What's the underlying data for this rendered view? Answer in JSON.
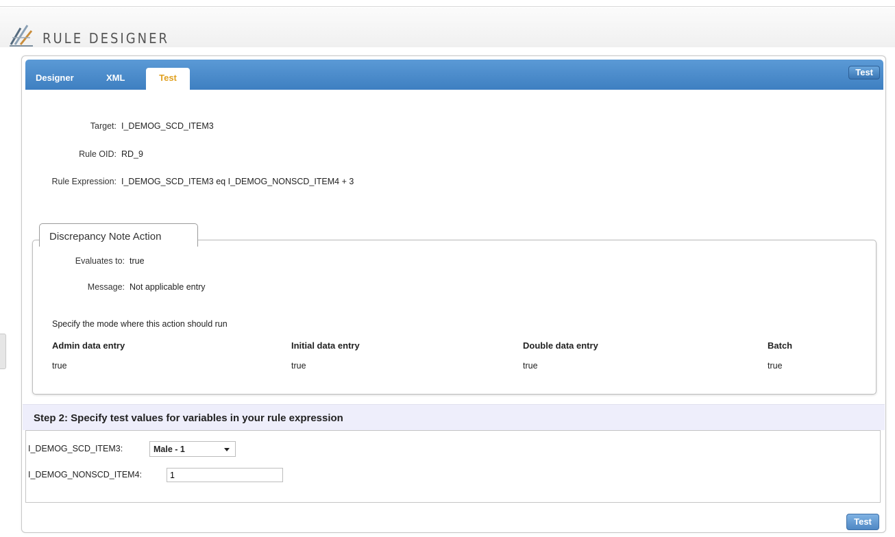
{
  "app": {
    "title": "RULE DESIGNER",
    "logo_icon": "rule-designer-logo-icon"
  },
  "tabs": [
    {
      "label": "Designer",
      "active": false
    },
    {
      "label": "XML",
      "active": false
    },
    {
      "label": "Test",
      "active": true
    }
  ],
  "toolbar": {
    "test_button_label": "Test"
  },
  "rule": {
    "target_label": "Target:",
    "target_value": "I_DEMOG_SCD_ITEM3",
    "oid_label": "Rule OID:",
    "oid_value": "RD_9",
    "expression_label": "Rule Expression:",
    "expression_value": "I_DEMOG_SCD_ITEM3 eq I_DEMOG_NONSCD_ITEM4 + 3"
  },
  "action": {
    "tab_title": "Discrepancy Note Action",
    "evaluates_label": "Evaluates to:",
    "evaluates_value": "true",
    "message_label": "Message:",
    "message_value": "Not applicable entry",
    "mode_prompt": "Specify the mode where this action should run",
    "modes": [
      {
        "header": "Admin data entry",
        "value": "true"
      },
      {
        "header": "Initial data entry",
        "value": "true"
      },
      {
        "header": "Double data entry",
        "value": "true"
      },
      {
        "header": "Batch",
        "value": "true"
      }
    ]
  },
  "step2": {
    "title": "Step 2: Specify test values for variables in your rule expression",
    "var1_label": "I_DEMOG_SCD_ITEM3:",
    "var1_selected": "Male - 1",
    "var2_label": "I_DEMOG_NONSCD_ITEM4:",
    "var2_value": "1"
  },
  "footer": {
    "test_button_label": "Test"
  },
  "colors": {
    "tab_bar": "#4a8ccd",
    "active_tab_text": "#e0a020",
    "step_bar_bg": "#eeeefb"
  }
}
